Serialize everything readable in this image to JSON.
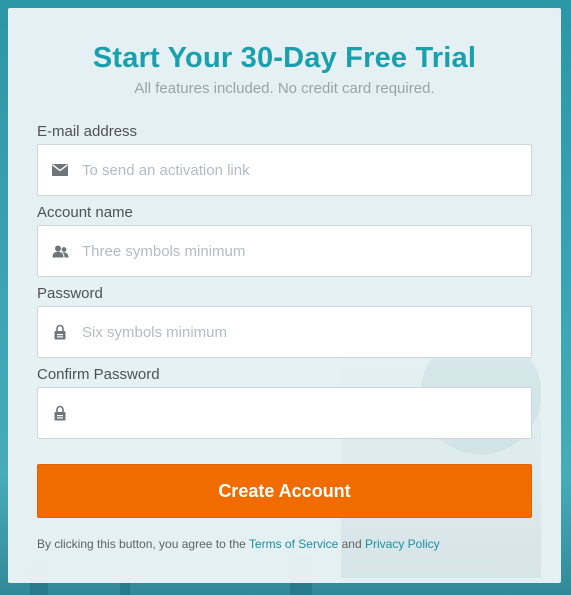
{
  "header": {
    "title": "Start Your 30-Day Free Trial",
    "subtitle": "All features included. No credit card required."
  },
  "form": {
    "email": {
      "label": "E-mail address",
      "placeholder": "To send an activation link",
      "value": "",
      "icon": "envelope-icon"
    },
    "account": {
      "label": "Account name",
      "placeholder": "Three symbols minimum",
      "value": "",
      "icon": "users-icon"
    },
    "password": {
      "label": "Password",
      "placeholder": "Six symbols minimum",
      "value": "",
      "icon": "lock-icon"
    },
    "confirm": {
      "label": "Confirm Password",
      "placeholder": "",
      "value": "",
      "icon": "lock-icon"
    },
    "submit_label": "Create Account"
  },
  "footer": {
    "prefix": "By clicking this button, you agree to the",
    "terms_link": "Terms of Service",
    "and": "and",
    "privacy_link": "Privacy Policy"
  },
  "colors": {
    "accent": "#18a0ad",
    "button": "#f06c00",
    "link": "#1a8fa0"
  }
}
